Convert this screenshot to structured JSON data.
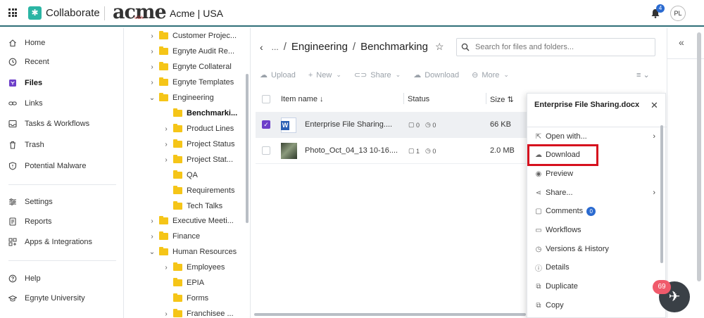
{
  "header": {
    "app_name": "Collaborate",
    "brand": "acme",
    "brand_sub": "USA",
    "org": "Acme | USA",
    "notification_count": "4",
    "avatar_initials": "PL",
    "accent_color": "#2bb5a4"
  },
  "nav": {
    "items": [
      {
        "label": "Home",
        "icon": "home-icon"
      },
      {
        "label": "Recent",
        "icon": "clock-icon"
      },
      {
        "label": "Files",
        "icon": "files-icon"
      },
      {
        "label": "Links",
        "icon": "link-icon"
      },
      {
        "label": "Tasks & Workflows",
        "icon": "tasks-icon"
      },
      {
        "label": "Trash",
        "icon": "trash-icon"
      },
      {
        "label": "Potential Malware",
        "icon": "shield-icon"
      },
      {
        "label": "Settings",
        "icon": "sliders-icon"
      },
      {
        "label": "Reports",
        "icon": "report-icon"
      },
      {
        "label": "Apps & Integrations",
        "icon": "apps-icon"
      },
      {
        "label": "Help",
        "icon": "help-icon"
      },
      {
        "label": "Egnyte University",
        "icon": "graduation-icon"
      }
    ]
  },
  "tree": {
    "items": [
      {
        "label": "Customer Projec...",
        "chevron": "›"
      },
      {
        "label": "Egnyte Audit Re...",
        "chevron": "›"
      },
      {
        "label": "Egnyte Collateral",
        "chevron": "›"
      },
      {
        "label": "Egnyte Templates",
        "chevron": "›"
      },
      {
        "label": "Engineering",
        "chevron": "⌄"
      },
      {
        "label": "Benchmarki...",
        "chevron": ""
      },
      {
        "label": "Product Lines",
        "chevron": "›"
      },
      {
        "label": "Project Status",
        "chevron": "›"
      },
      {
        "label": "Project Stat...",
        "chevron": "›"
      },
      {
        "label": "QA",
        "chevron": ""
      },
      {
        "label": "Requirements",
        "chevron": ""
      },
      {
        "label": "Tech Talks",
        "chevron": ""
      },
      {
        "label": "Executive Meeti...",
        "chevron": "›"
      },
      {
        "label": "Finance",
        "chevron": "›"
      },
      {
        "label": "Human Resources",
        "chevron": "⌄"
      },
      {
        "label": "Employees",
        "chevron": "›"
      },
      {
        "label": "EPIA",
        "chevron": ""
      },
      {
        "label": "Forms",
        "chevron": ""
      },
      {
        "label": "Franchisee ...",
        "chevron": "›"
      }
    ]
  },
  "breadcrumb": {
    "ellipsis": "...",
    "sep": "/",
    "parent": "Engineering",
    "current": "Benchmarking"
  },
  "search": {
    "placeholder": "Search for files and folders..."
  },
  "toolbar": {
    "upload": "Upload",
    "new": "New",
    "share": "Share",
    "download": "Download",
    "more": "More"
  },
  "table": {
    "col_name": "Item name",
    "col_status": "Status",
    "col_size": "Size",
    "rows": [
      {
        "name": "Enterprise File Sharing....",
        "comments": "0",
        "versions": "0",
        "size": "66 KB",
        "selected": true
      },
      {
        "name": "Photo_Oct_04_13 10-16....",
        "comments": "1",
        "versions": "0",
        "size": "2.0 MB",
        "selected": false
      }
    ]
  },
  "panel": {
    "title": "Enterprise File Sharing.docx",
    "actions": [
      {
        "label": "Open with...",
        "icon": "open-external-icon",
        "arrow": "›"
      },
      {
        "label": "Download",
        "icon": "cloud-download-icon",
        "arrow": ""
      },
      {
        "label": "Preview",
        "icon": "eye-icon",
        "arrow": ""
      },
      {
        "label": "Share...",
        "icon": "share-icon",
        "arrow": "›"
      },
      {
        "label": "Comments",
        "icon": "comment-icon",
        "arrow": "",
        "badge": "0"
      },
      {
        "label": "Workflows",
        "icon": "inbox-icon",
        "arrow": ""
      },
      {
        "label": "Versions & History",
        "icon": "history-icon",
        "arrow": ""
      },
      {
        "label": "Details",
        "icon": "info-icon",
        "arrow": ""
      },
      {
        "label": "Duplicate",
        "icon": "duplicate-icon",
        "arrow": ""
      },
      {
        "label": "Copy",
        "icon": "copy-icon",
        "arrow": ""
      }
    ]
  },
  "fab": {
    "badge": "69"
  }
}
